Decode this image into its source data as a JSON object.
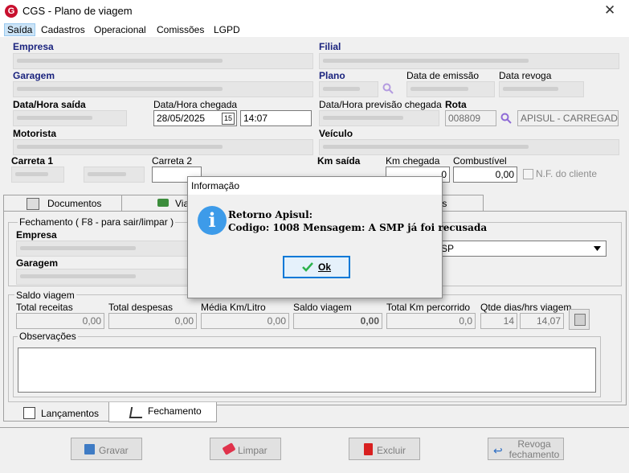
{
  "window": {
    "title": "CGS - Plano de viagem",
    "app_icon_letter": "G",
    "close_glyph": "✕"
  },
  "menu": [
    "Saída",
    "Cadastros",
    "Operacional",
    "Comissões",
    "LGPD"
  ],
  "labels": {
    "empresa": "Empresa",
    "filial": "Filial",
    "garagem": "Garagem",
    "plano": "Plano",
    "data_emissao": "Data de emissão",
    "data_revoga": "Data revoga",
    "data_hora_saida": "Data/Hora saída",
    "data_hora_chegada": "Data/Hora chegada",
    "data_hora_previsao": "Data/Hora previsão chegada",
    "rota": "Rota",
    "motorista": "Motorista",
    "veiculo": "Veículo",
    "carreta1": "Carreta 1",
    "carreta2": "Carreta 2",
    "km_saida": "Km saída",
    "km_chegada": "Km chegada",
    "combustivel": "Combustível",
    "nf_cliente": "N.F. do cliente"
  },
  "values": {
    "chegada_data": "28/05/2025",
    "chegada_hora": "14:07",
    "calendar_btn": "15",
    "rota_codigo": "008809",
    "rota_desc": "APISUL - CARREGADO -",
    "km_chegada": "0",
    "combustivel": "0,00"
  },
  "tabs": {
    "documentos": "Documentos",
    "viagem": "Via",
    "obs": "ões"
  },
  "fechamento": {
    "legend": "Fechamento ( F8 - para sair/limpar )",
    "empresa": "Empresa",
    "garagem": "Garagem",
    "select_value": "SP"
  },
  "saldo": {
    "legend": "Saldo viagem",
    "cols": [
      {
        "label": "Total receitas",
        "value": "0,00"
      },
      {
        "label": "Total despesas",
        "value": "0,00"
      },
      {
        "label": "Média Km/Litro",
        "value": "0,00"
      },
      {
        "label": "Saldo viagem",
        "value": "0,00"
      },
      {
        "label": "Total Km percorrido",
        "value": "0,0"
      },
      {
        "label": "Qtde dias/hrs viagem",
        "value": "14",
        "value2": "14,07"
      }
    ]
  },
  "observacoes": {
    "legend": "Observações"
  },
  "bottom_tabs": {
    "lancamentos": "Lançamentos",
    "fechamento": "Fechamento"
  },
  "buttons": {
    "gravar": "Gravar",
    "limpar": "Limpar",
    "excluir": "Excluir",
    "revoga1": "Revoga",
    "revoga2": "fechamento"
  },
  "dialog": {
    "title": "Informação",
    "line1": "Retorno Apisul:",
    "line2": "Codigo: 1008 Mensagem: A SMP já foi recusada",
    "ok": "Ok",
    "icon": "i"
  },
  "colors": {
    "accent": "#0078d7",
    "info": "#3d9be9",
    "brand": "#c8102e"
  }
}
